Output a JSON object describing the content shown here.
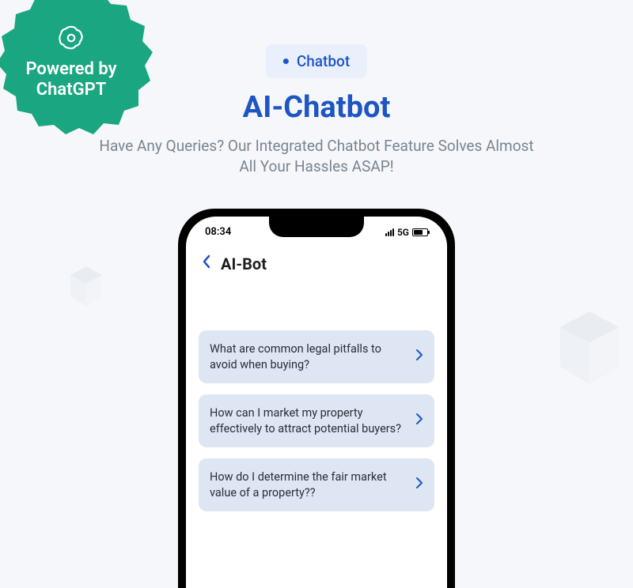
{
  "badge": {
    "line1": "Powered by",
    "line2": "ChatGPT"
  },
  "pill": "Chatbot",
  "title": "AI-Chatbot",
  "subtitle": "Have Any Queries? Our Integrated Chatbot Feature Solves Almost All Your Hassles ASAP!",
  "phone": {
    "time": "08:34",
    "network": "5G",
    "headerTitle": "AI-Bot",
    "suggestions": [
      "What are common legal pitfalls to avoid when buying?",
      "How can I market my property effectively to attract potential buyers?",
      "How do I determine the fair market value of a property??"
    ]
  }
}
